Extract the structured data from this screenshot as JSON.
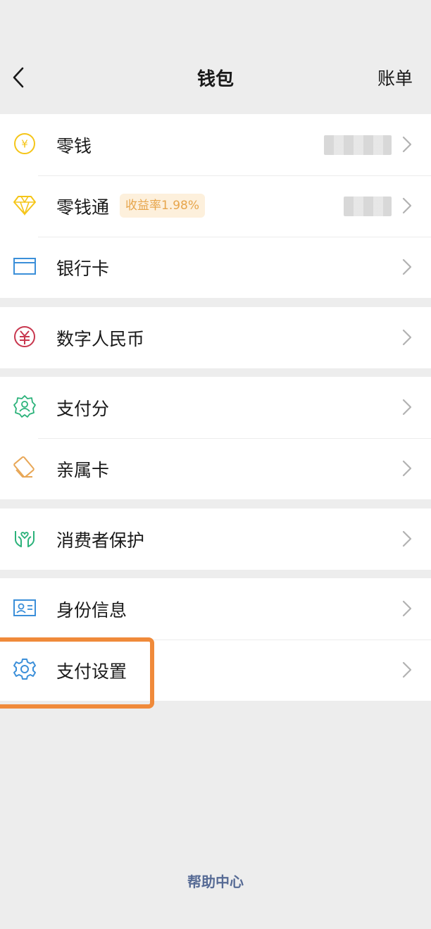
{
  "header": {
    "title": "钱包",
    "right_label": "账单",
    "back_icon": "chevron-left-icon"
  },
  "groups": [
    {
      "items": [
        {
          "label": "零钱",
          "icon": "yuan-coin-icon",
          "color": "#f5c518",
          "value_hidden": true
        },
        {
          "label": "零钱通",
          "icon": "diamond-icon",
          "color": "#f5c518",
          "badge": "收益率1.98%",
          "value_hidden": true
        },
        {
          "label": "银行卡",
          "icon": "bank-card-icon",
          "color": "#3b8fd9"
        }
      ]
    },
    {
      "items": [
        {
          "label": "数字人民币",
          "icon": "digital-rmb-icon",
          "color": "#c8374e"
        }
      ]
    },
    {
      "items": [
        {
          "label": "支付分",
          "icon": "payment-score-icon",
          "color": "#2bb27a"
        },
        {
          "label": "亲属卡",
          "icon": "family-card-icon",
          "color": "#e8a757"
        }
      ]
    },
    {
      "items": [
        {
          "label": "消费者保护",
          "icon": "hands-protect-icon",
          "color": "#2bb27a"
        }
      ]
    },
    {
      "items": [
        {
          "label": "身份信息",
          "icon": "id-card-icon",
          "color": "#3b8fd9"
        },
        {
          "label": "支付设置",
          "icon": "gear-icon",
          "color": "#3b8fd9",
          "highlighted": true
        }
      ]
    }
  ],
  "footer": {
    "help_label": "帮助中心"
  },
  "colors": {
    "highlight": "#f08a3a",
    "link": "#576b95",
    "badge_bg": "#fdf0dc",
    "badge_text": "#e7a54b"
  }
}
